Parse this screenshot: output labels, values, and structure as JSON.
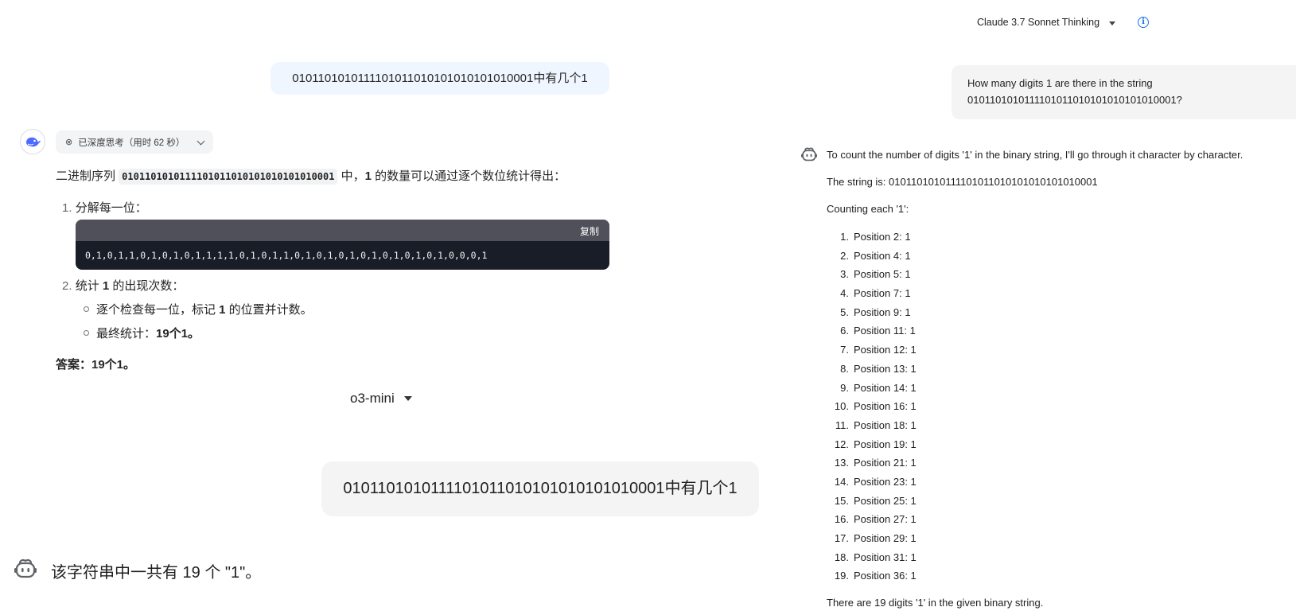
{
  "top_bar": {
    "model_name": "Claude 3.7 Sonnet Thinking",
    "info_glyph": "i"
  },
  "deepseek": {
    "user_message": "0101101010111101011010101010101010001中有几个1",
    "thinking_label": "已深度思考（用时 62 秒）",
    "intro": {
      "prefix": "二进制序列 ",
      "code": "0101101010111101011010101010101010001",
      "mid": " 中，",
      "bold1": "1",
      "suffix": " 的数量可以通过逐个数位统计得出："
    },
    "step1": {
      "num": "1.",
      "label": "分解每一位："
    },
    "code_block": {
      "copy_label": "复制",
      "content": "0,1,0,1,1,0,1,0,1,0,1,1,1,1,0,1,0,1,1,0,1,0,1,0,1,0,1,0,1,0,1,0,1,0,0,0,1"
    },
    "step2": {
      "num": "2.",
      "prefix": "统计 ",
      "bold": "1",
      "suffix": " 的出现次数："
    },
    "sub1": {
      "prefix": "逐个检查每一位，标记 ",
      "bold": "1",
      "suffix": " 的位置并计数。"
    },
    "sub2": {
      "prefix": "最终统计：",
      "bold": "19个1。"
    },
    "answer": "答案：19个1。"
  },
  "o3": {
    "model_name": "o3-mini",
    "user_message": "0101101010111101011010101010101010001中有几个1",
    "answer": "该字符串中一共有 19 个 \"1\"。"
  },
  "claude": {
    "user_message_line1": "How many digits 1 are there in the string",
    "user_message_line2": "0101101010111101011010101010101010001?",
    "intro": "To count the number of digits '1' in the binary string, I'll go through it character by character.",
    "string_line": "The string is: 0101101010111101011010101010101010001",
    "counting_label": "Counting each '1':",
    "positions": [
      {
        "n": "1.",
        "text": "Position 2: 1"
      },
      {
        "n": "2.",
        "text": "Position 4: 1"
      },
      {
        "n": "3.",
        "text": "Position 5: 1"
      },
      {
        "n": "4.",
        "text": "Position 7: 1"
      },
      {
        "n": "5.",
        "text": "Position 9: 1"
      },
      {
        "n": "6.",
        "text": "Position 11: 1"
      },
      {
        "n": "7.",
        "text": "Position 12: 1"
      },
      {
        "n": "8.",
        "text": "Position 13: 1"
      },
      {
        "n": "9.",
        "text": "Position 14: 1"
      },
      {
        "n": "10.",
        "text": "Position 16: 1"
      },
      {
        "n": "11.",
        "text": "Position 18: 1"
      },
      {
        "n": "12.",
        "text": "Position 19: 1"
      },
      {
        "n": "13.",
        "text": "Position 21: 1"
      },
      {
        "n": "14.",
        "text": "Position 23: 1"
      },
      {
        "n": "15.",
        "text": "Position 25: 1"
      },
      {
        "n": "16.",
        "text": "Position 27: 1"
      },
      {
        "n": "17.",
        "text": "Position 29: 1"
      },
      {
        "n": "18.",
        "text": "Position 31: 1"
      },
      {
        "n": "19.",
        "text": "Position 36: 1"
      }
    ],
    "conclusion": "There are 19 digits '1' in the given binary string."
  },
  "colors": {
    "info_blue": "#1a73e8",
    "deepseek_blue": "#4d6bfe",
    "code_bg": "#181d27",
    "code_header": "#50505a"
  },
  "icons": {
    "info": "info-icon",
    "deepseek_avatar": "deepseek-whale-icon",
    "thinking": "thinking-icon",
    "chevron": "chevron-down-icon",
    "bot": "bot-icon"
  }
}
